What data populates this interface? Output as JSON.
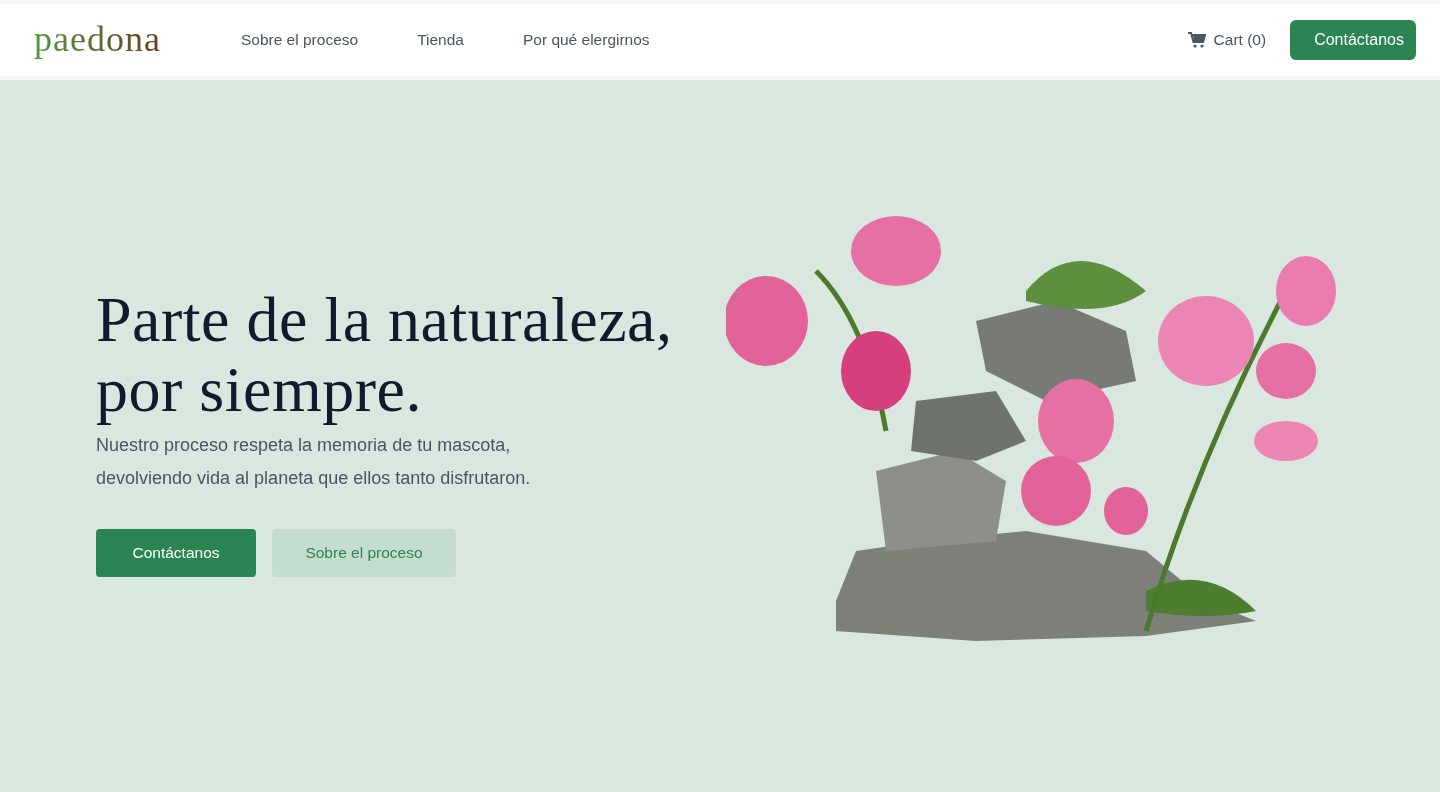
{
  "logo": "paedona",
  "nav": {
    "links": [
      {
        "label": "Sobre el proceso"
      },
      {
        "label": "Tienda"
      },
      {
        "label": "Por qué elergirnos"
      }
    ],
    "cart": "Cart (0)",
    "cta": "Contáctanos"
  },
  "hero": {
    "title_lines": [
      "Parte de la naturaleza,",
      "por siempre."
    ],
    "subtitle": "Nuestro proceso respeta la memoria de tu mascota, devolviendo vida al planeta que ellos tanto disfrutaron.",
    "buttons": [
      {
        "label": "Contáctanos",
        "kind": "primary"
      },
      {
        "label": "Sobre el proceso",
        "kind": "secondary"
      }
    ]
  }
}
